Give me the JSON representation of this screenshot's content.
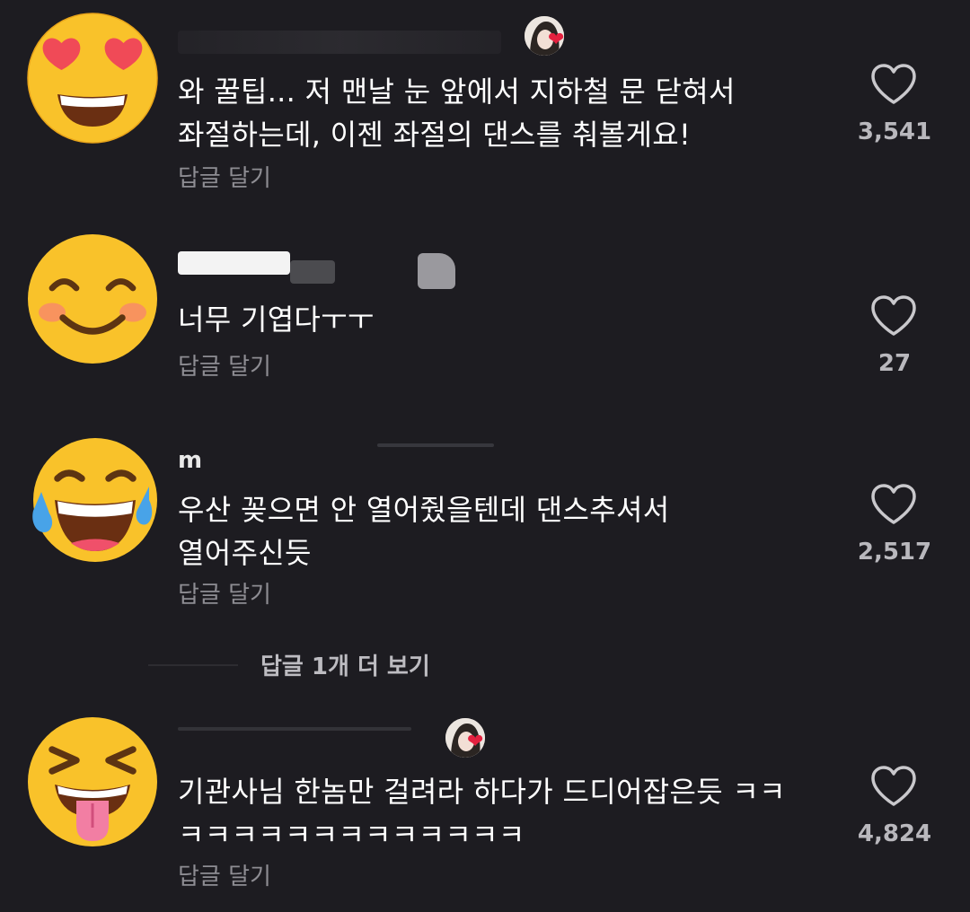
{
  "comments": [
    {
      "avatar_icon": "heart-eyes-emoji-icon",
      "username": "",
      "text": "와 꿀팁... 저 맨날 눈 앞에서 지하철 문 닫혀서\n좌절하는데, 이젠 좌절의 댄스를 춰볼게요!",
      "reply_label": "답글 달기",
      "like_count": "3,541"
    },
    {
      "avatar_icon": "smiling-blush-emoji-icon",
      "username": "",
      "text": "너무 기엽다ㅜㅜ",
      "reply_label": "답글 달기",
      "like_count": "27"
    },
    {
      "avatar_icon": "tears-of-joy-emoji-icon",
      "username": "m",
      "text": "우산 꽂으면 안 열어줬을텐데 댄스추셔서\n열어주신듯",
      "reply_label": "답글 달기",
      "like_count": "2,517"
    },
    {
      "avatar_icon": "squinting-tongue-emoji-icon",
      "username": "",
      "text": "기관사님 한놈만 걸려라 하다가 드디어잡은듯 ㅋㅋ\nㅋㅋㅋㅋㅋㅋㅋㅋㅋㅋㅋㅋㅋ",
      "reply_label": "답글 달기",
      "like_count": "4,824"
    }
  ],
  "view_more_replies": "답글 1개 더 보기",
  "colors": {
    "background": "#1d1c21",
    "text": "#ffffff",
    "secondary_text": "#8e8d93",
    "like_heart": "#c9c8cc"
  }
}
